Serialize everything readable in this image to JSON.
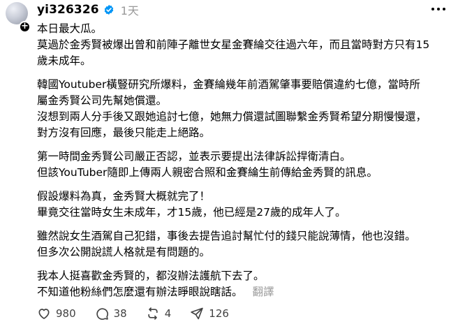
{
  "user": {
    "username": "yi326326",
    "time": "1天"
  },
  "post": {
    "paragraphs": [
      "本日最大瓜。",
      "莫過於金秀賢被爆出曾和前陣子離世女星金賽綸交往過六年，而且當時對方只有15\n歲未成年。",
      "韓國Youtuber橫豎研究所爆料，金賽綸幾年前酒駕肇事要賠償違約七億，當時所\n屬金秀賢公司先幫她償還。\n沒想到兩人分手後又跟她追討七億，她無力償還試圖聯繫金秀賢希望分期慢慢還，\n對方沒有回應，最後只能走上絕路。",
      "第一時間金秀賢公司嚴正否認，並表示要提出法律訴訟捍衛清白。\n但該YouTuber隨即上傳兩人親密合照和金賽綸生前傳給金秀賢的訊息。",
      "假設爆料為真，金秀賢大概就完了！\n畢竟交往當時女生未成年，才15歲，他已經是27歲的成年人了。",
      "雖然說女生酒駕自己犯錯，事後去提告追討幫忙付的錢只能說薄情，他也沒錯。\n但多次公開說謊人格就是有問題的。",
      "我本人挺喜歡金秀賢的，都沒辦法護航下去了。\n不知道他粉絲們怎麼還有辦法睜眼說瞎話。"
    ],
    "translate_label": "翻譯"
  },
  "actions": {
    "likes": "980",
    "comments": "38",
    "reposts": "4",
    "shares": "126"
  },
  "icons": {
    "verified": "verified-badge-icon",
    "more": "more-options-icon",
    "like": "heart-icon",
    "comment": "comment-icon",
    "repost": "repost-icon",
    "share": "send-icon"
  },
  "colors": {
    "verified": "#0095f6",
    "muted": "#999999",
    "text": "#000000"
  }
}
